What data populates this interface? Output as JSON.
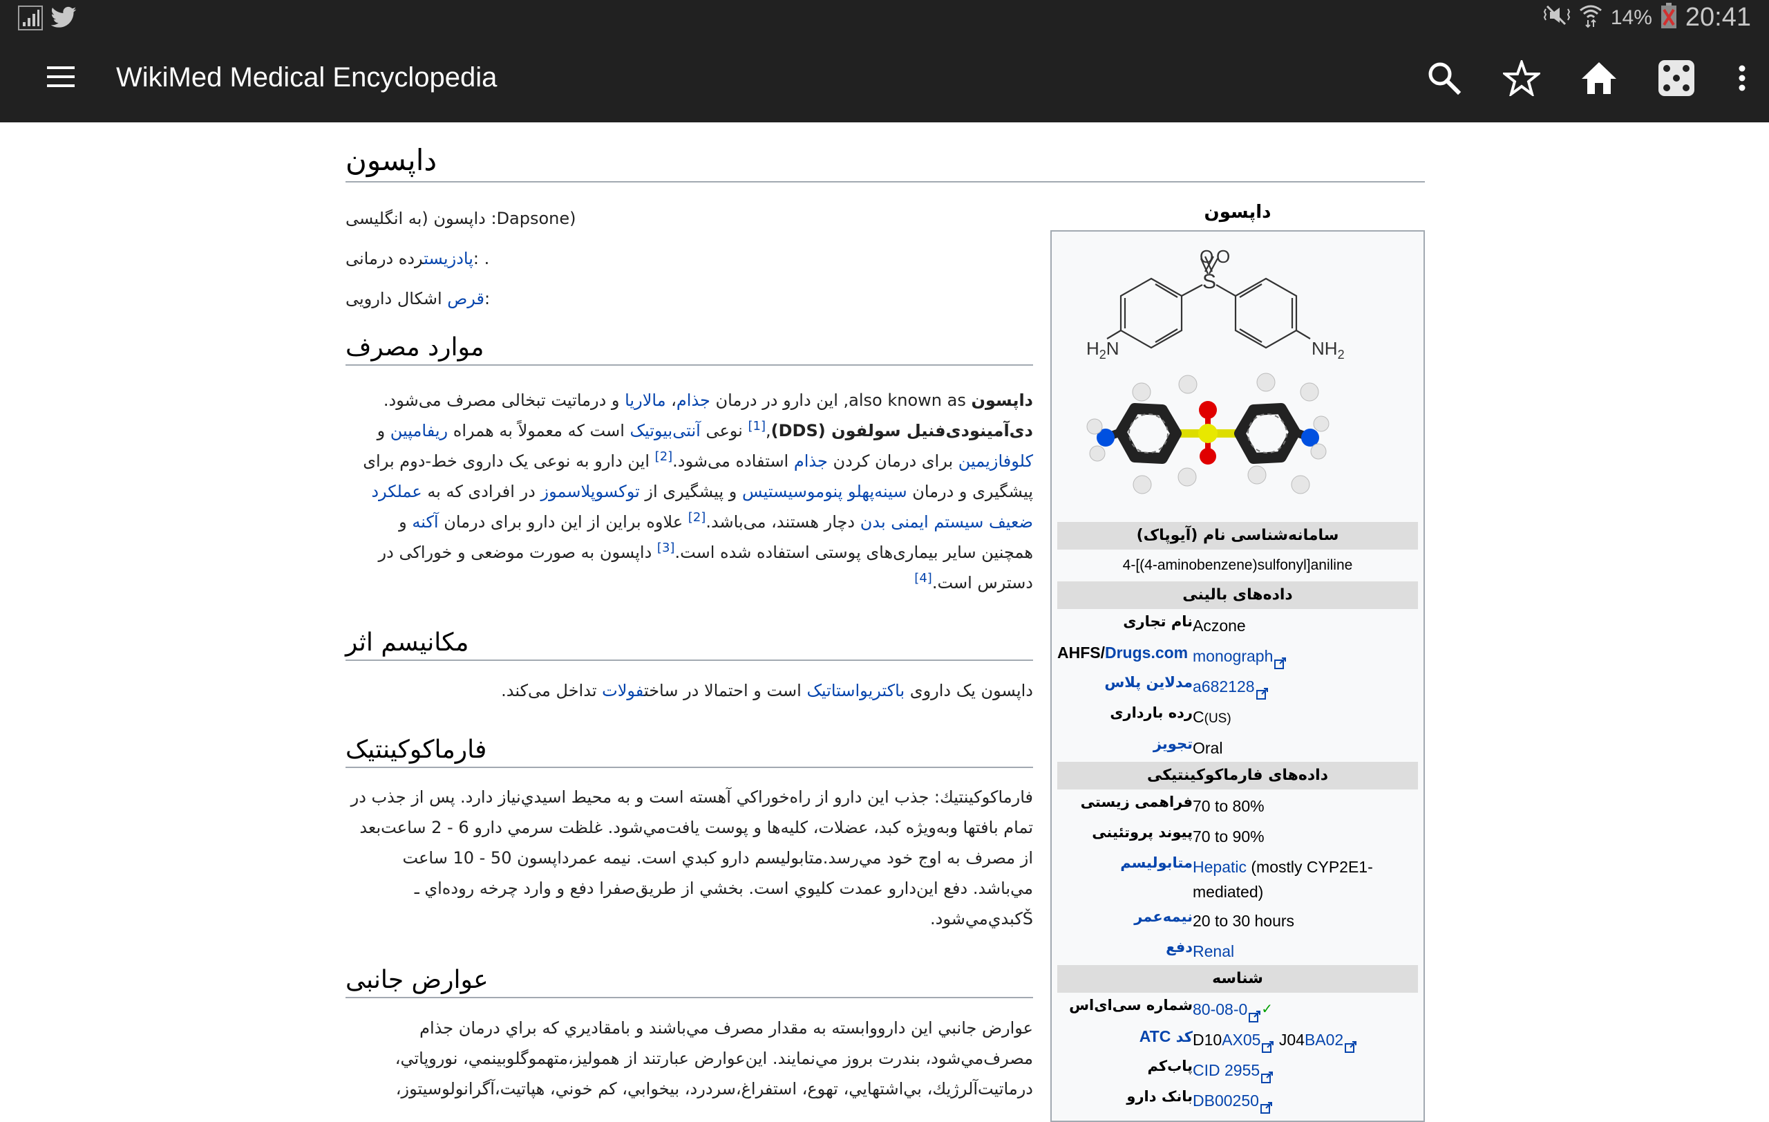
{
  "status_bar": {
    "battery_percent": "14%",
    "clock": "20:41",
    "icons": [
      "signal-bars-icon",
      "twitter-icon",
      "mute-vibrate-icon",
      "wifi-icon",
      "battery-low-icon"
    ]
  },
  "app_bar": {
    "title": "WikiMed Medical Encyclopedia",
    "actions": [
      "search-icon",
      "bookmark-star-icon",
      "home-icon",
      "random-dice-icon",
      "more-vert-icon"
    ]
  },
  "article": {
    "title": "داپسون",
    "intro": {
      "line1_prefix": "داپسون (به انگلیسی",
      "line1_bold": "داپسون",
      "line1_rest": ":Dapsone)",
      "class_label": "رده درمانی: ",
      "class_link": "پادزیست",
      "class_suffix": " .",
      "forms_label": "اشکال دارویی: ",
      "forms_link": "قرص"
    },
    "sections": [
      {
        "heading": "موارد مصرف",
        "paragraph": {
          "segments": [
            {
              "t": "داپسون",
              "b": true
            },
            {
              "t": " also known as, این دارو در درمان "
            },
            {
              "t": "جذام",
              "link": true
            },
            {
              "t": "، "
            },
            {
              "t": "مالاریا",
              "link": true
            },
            {
              "t": " و درماتیت تبخالی مصرف می‌شود. "
            },
            {
              "t": "دی‌آمینودی‌فنیل سولفون",
              "b": true
            },
            {
              "t": " (DDS)",
              "b": true
            },
            {
              "t": ","
            },
            {
              "t": "[1]",
              "sup": true
            },
            {
              "t": " نوعی "
            },
            {
              "t": "آنتی‌بیوتیک",
              "link": true
            },
            {
              "t": " است که معمولاً به همراه "
            },
            {
              "t": "ریفامپین",
              "link": true
            },
            {
              "t": " و "
            },
            {
              "t": "کلوفازیمین",
              "link": true
            },
            {
              "t": " برای درمان کردن "
            },
            {
              "t": "جذام",
              "link": true
            },
            {
              "t": " استفاده می‌شود."
            },
            {
              "t": "[2]",
              "sup": true
            },
            {
              "t": " این دارو به نوعی یک داروی خط-دوم برای پیشگیری و درمان "
            },
            {
              "t": "سینه‌پهلو پنوموسیستیس",
              "link": true
            },
            {
              "t": " و پیشگیری از "
            },
            {
              "t": "توکسوپلاسموز",
              "link": true
            },
            {
              "t": " در افرادی که به "
            },
            {
              "t": "عملکرد ضعیف سیستم ایمنی بدن",
              "link": true
            },
            {
              "t": " دچار هستند، می‌باشد."
            },
            {
              "t": "[2]",
              "sup": true
            },
            {
              "t": " علاوه براین از این دارو برای درمان "
            },
            {
              "t": "آکنه",
              "link": true
            },
            {
              "t": " و همچنین سایر بیماری‌های پوستی استفاده شده است."
            },
            {
              "t": "[3]",
              "sup": true
            },
            {
              "t": " داپسون به صورت موضعی و خوراکی در دسترس است."
            },
            {
              "t": "[4]",
              "sup": true
            }
          ]
        }
      },
      {
        "heading": "مکانیسم اثر",
        "paragraph": {
          "segments": [
            {
              "t": "داپسون یک داروی "
            },
            {
              "t": "باکتریواستاتیک",
              "link": true
            },
            {
              "t": " است و احتمالا در ساخت"
            },
            {
              "t": "فولات",
              "link": true
            },
            {
              "t": " تداخل می‌کند."
            }
          ]
        }
      },
      {
        "heading": "فارماکوکینتیک",
        "paragraph": {
          "segments": [
            {
              "t": "فارماكوكينتيك: جذب اين دارو از راه‌خوراكي آهسته است و به محيط اسيدي‌نياز دارد. پس از جذب در تمام بافتها وبه‌ويژه كبد، عضلات، كليه‌ها و پوست يافت‌مي‌شود. غلظت سرمي دارو 6 - 2 ساعت‌بعد از مصرف به اوج خود مي‌رسد.متابوليسم دارو كبدي است. نيمه عمرداپسون 50 - 10 ساعت مي‌باشد. دفع اين‌دارو عمدت كليوي است. بخشي از طريق‌صفرا دفع و وارد چرخه روده‌اي ـ Šكبدي‌مي‌شود."
            }
          ]
        }
      },
      {
        "heading": "عوارض جانبی",
        "paragraph": {
          "segments": [
            {
              "t": "عوارض جانبي اين داروو‌ابسته به مقدار مصرف مي‌باشند و بامقاديري كه براي درمان جذام مصرف‌مي‌شود، بندرت بروز مي‌نمايند. اين‌عوارض عبارتند از هموليز،متهموگلوبينمي، نوروپاتي، درماتيت‌آلرژيك، بي‌اشتهايي، تهوع، استفراغ،سردرد، بيخوابي، كم خوني، هپاتيت،آگرانولوسيتوز،"
            }
          ]
        }
      }
    ]
  },
  "infobox": {
    "caption": "داپسون",
    "image_alt": [
      "skeletal-formula",
      "ball-and-stick-model"
    ],
    "iupac_header": "(سامانه‌شناسی نام (آیوپاک",
    "iupac_name": "4-[(4-aminobenzene)sulfonyl]aniline",
    "clinical_header": "داده‌های بالینی",
    "clinical_rows": [
      {
        "label": "نام تجاری",
        "label_link": false,
        "value": "Aczone"
      },
      {
        "label": "AHFS/Drugs.com",
        "label_link": "partial",
        "value": "monograph",
        "value_link": true,
        "ext": true
      },
      {
        "label": "مدلاین پلاس",
        "label_link": true,
        "value": "a682128",
        "value_link": true,
        "ext": true
      },
      {
        "label": "رده بارداری",
        "label_link": false,
        "value": "C",
        "value_suffix": "(US)"
      },
      {
        "label": "تجویز",
        "label_link": true,
        "value": "Oral"
      }
    ],
    "pk_header": "داده‌های فارماکوکینتیکی",
    "pk_rows": [
      {
        "label": "فراهمی زیستی",
        "label_link": false,
        "value": "70 to 80%"
      },
      {
        "label": "پیوند پروتئینی",
        "label_link": false,
        "value": "70 to 90%"
      },
      {
        "label": "متابولیسم",
        "label_link": true,
        "value_link_part": "Hepatic",
        "value": " (mostly CYP2E1-mediated)"
      },
      {
        "label": "نیمه‌عمر",
        "label_link": true,
        "value": "20 to 30 hours"
      },
      {
        "label": "دفع",
        "label_link": true,
        "value": "Renal",
        "value_link": true
      }
    ],
    "id_header": "شناسه",
    "id_rows": [
      {
        "label": "شماره سی‌ای‌اس",
        "value": "80-08-0",
        "value_link": true,
        "ext": true,
        "verified": "✓"
      },
      {
        "label": "کد",
        "label_bold_link": "ATC",
        "atc": [
          {
            "prefix": "D10",
            "link": "AX05"
          },
          {
            "prefix": "J04",
            "link": "BA02"
          }
        ]
      },
      {
        "label": "پاب‌کم",
        "value": "CID 2955",
        "value_link": true,
        "ext": true
      },
      {
        "label": "بانک دارو",
        "value": "DB00250",
        "value_link": true,
        "ext": true
      }
    ]
  }
}
